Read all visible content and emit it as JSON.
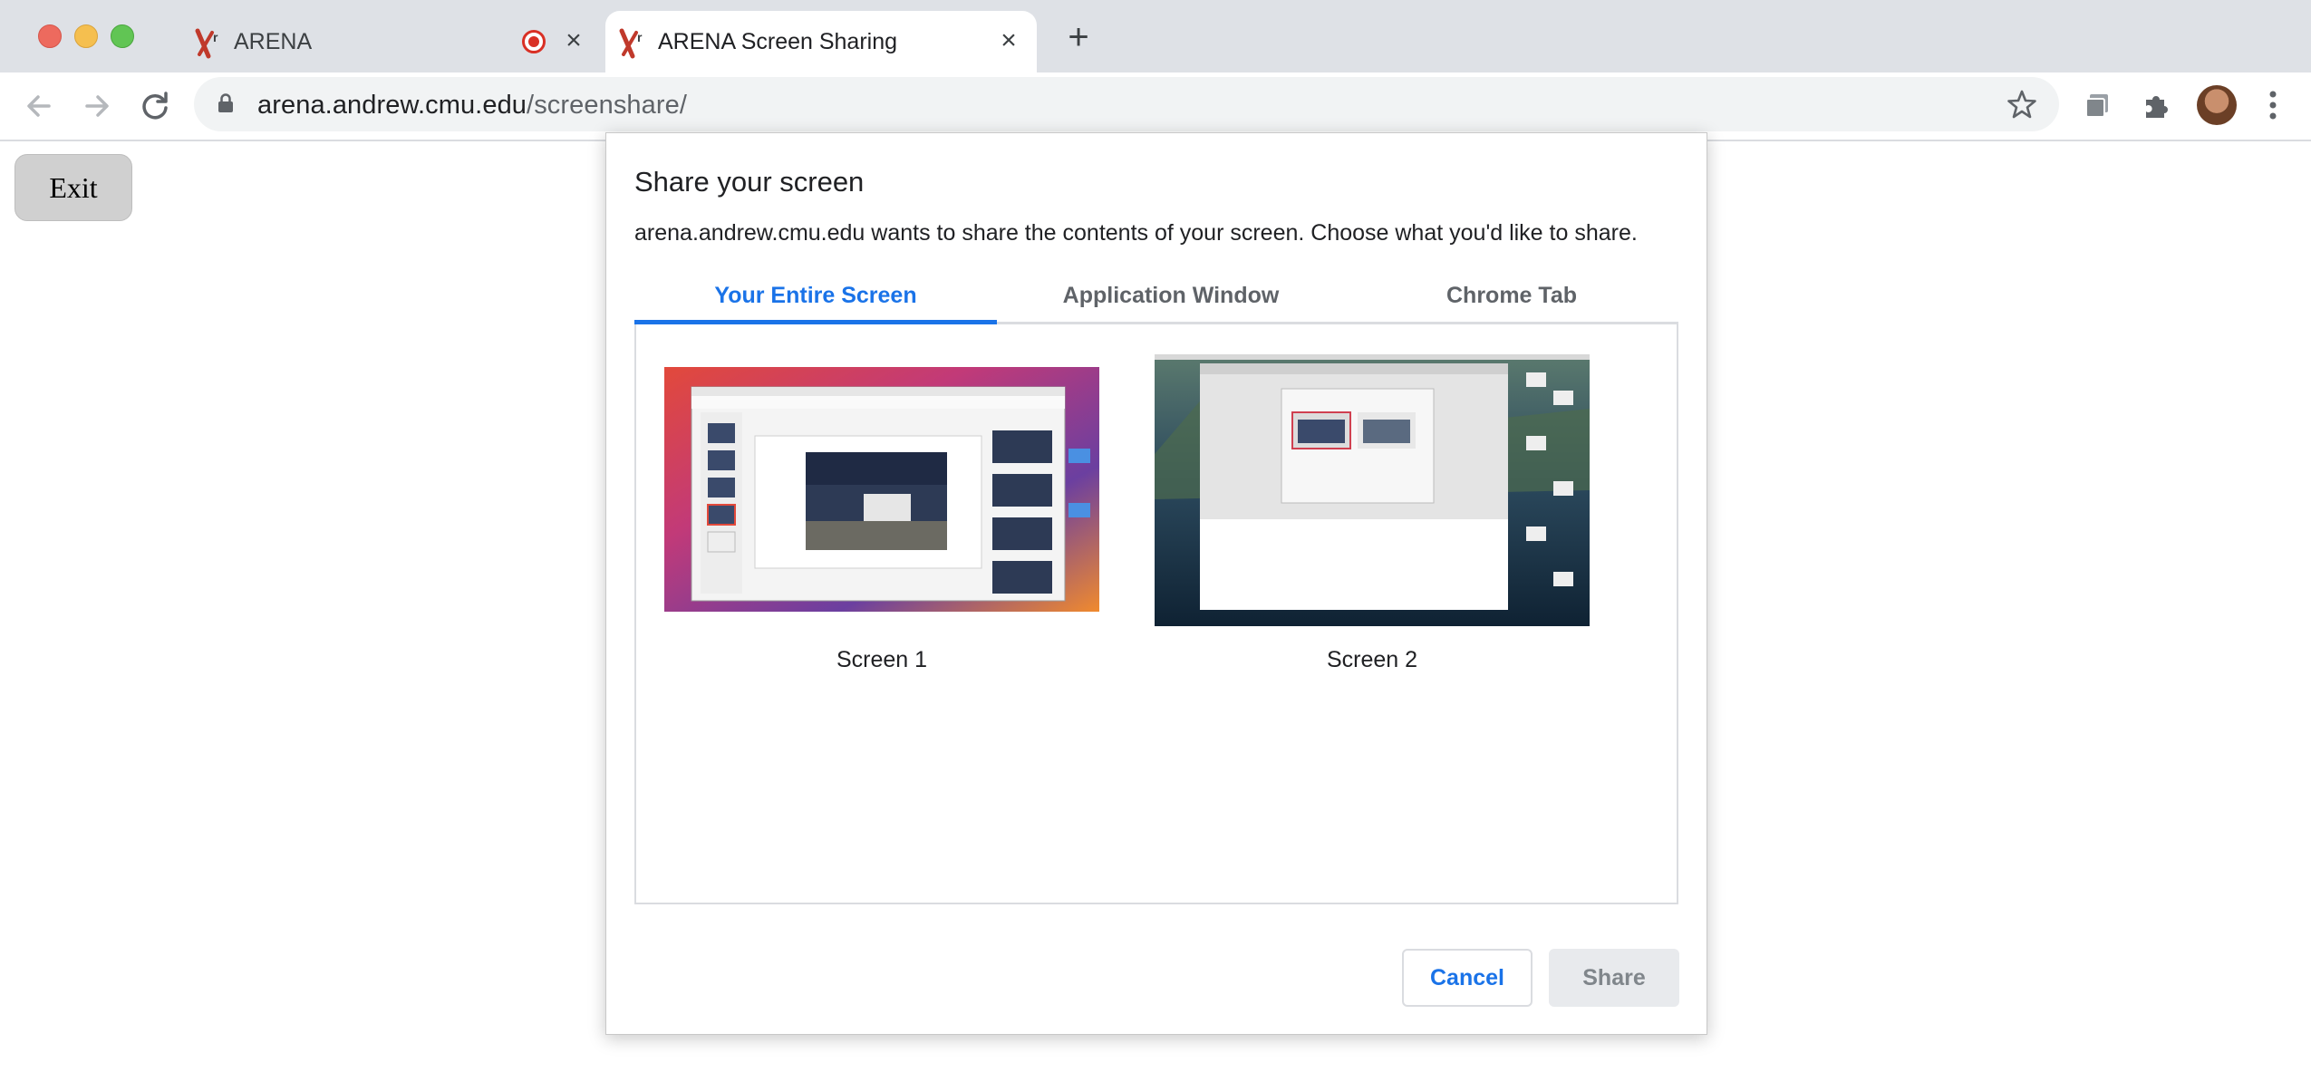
{
  "browser": {
    "tabs": [
      {
        "title": "ARENA",
        "active": false,
        "recording": true
      },
      {
        "title": "ARENA Screen Sharing",
        "active": true,
        "recording": false
      }
    ],
    "new_tab_label": "+",
    "address": {
      "host": "arena.andrew.cmu.edu",
      "path": "/screenshare/"
    }
  },
  "page": {
    "exit_label": "Exit"
  },
  "dialog": {
    "title": "Share your screen",
    "description": "arena.andrew.cmu.edu wants to share the contents of your screen. Choose what you'd like to share.",
    "tabs": [
      "Your Entire Screen",
      "Application Window",
      "Chrome Tab"
    ],
    "selected_tab": "Your Entire Screen",
    "sources": [
      {
        "label": "Screen 1"
      },
      {
        "label": "Screen 2"
      }
    ],
    "cancel_label": "Cancel",
    "share_label": "Share",
    "share_enabled": false
  },
  "colors": {
    "accent": "#1a73e8",
    "tabstrip": "#dee1e6",
    "omnibox": "#f1f3f4",
    "recording": "#d93025"
  }
}
